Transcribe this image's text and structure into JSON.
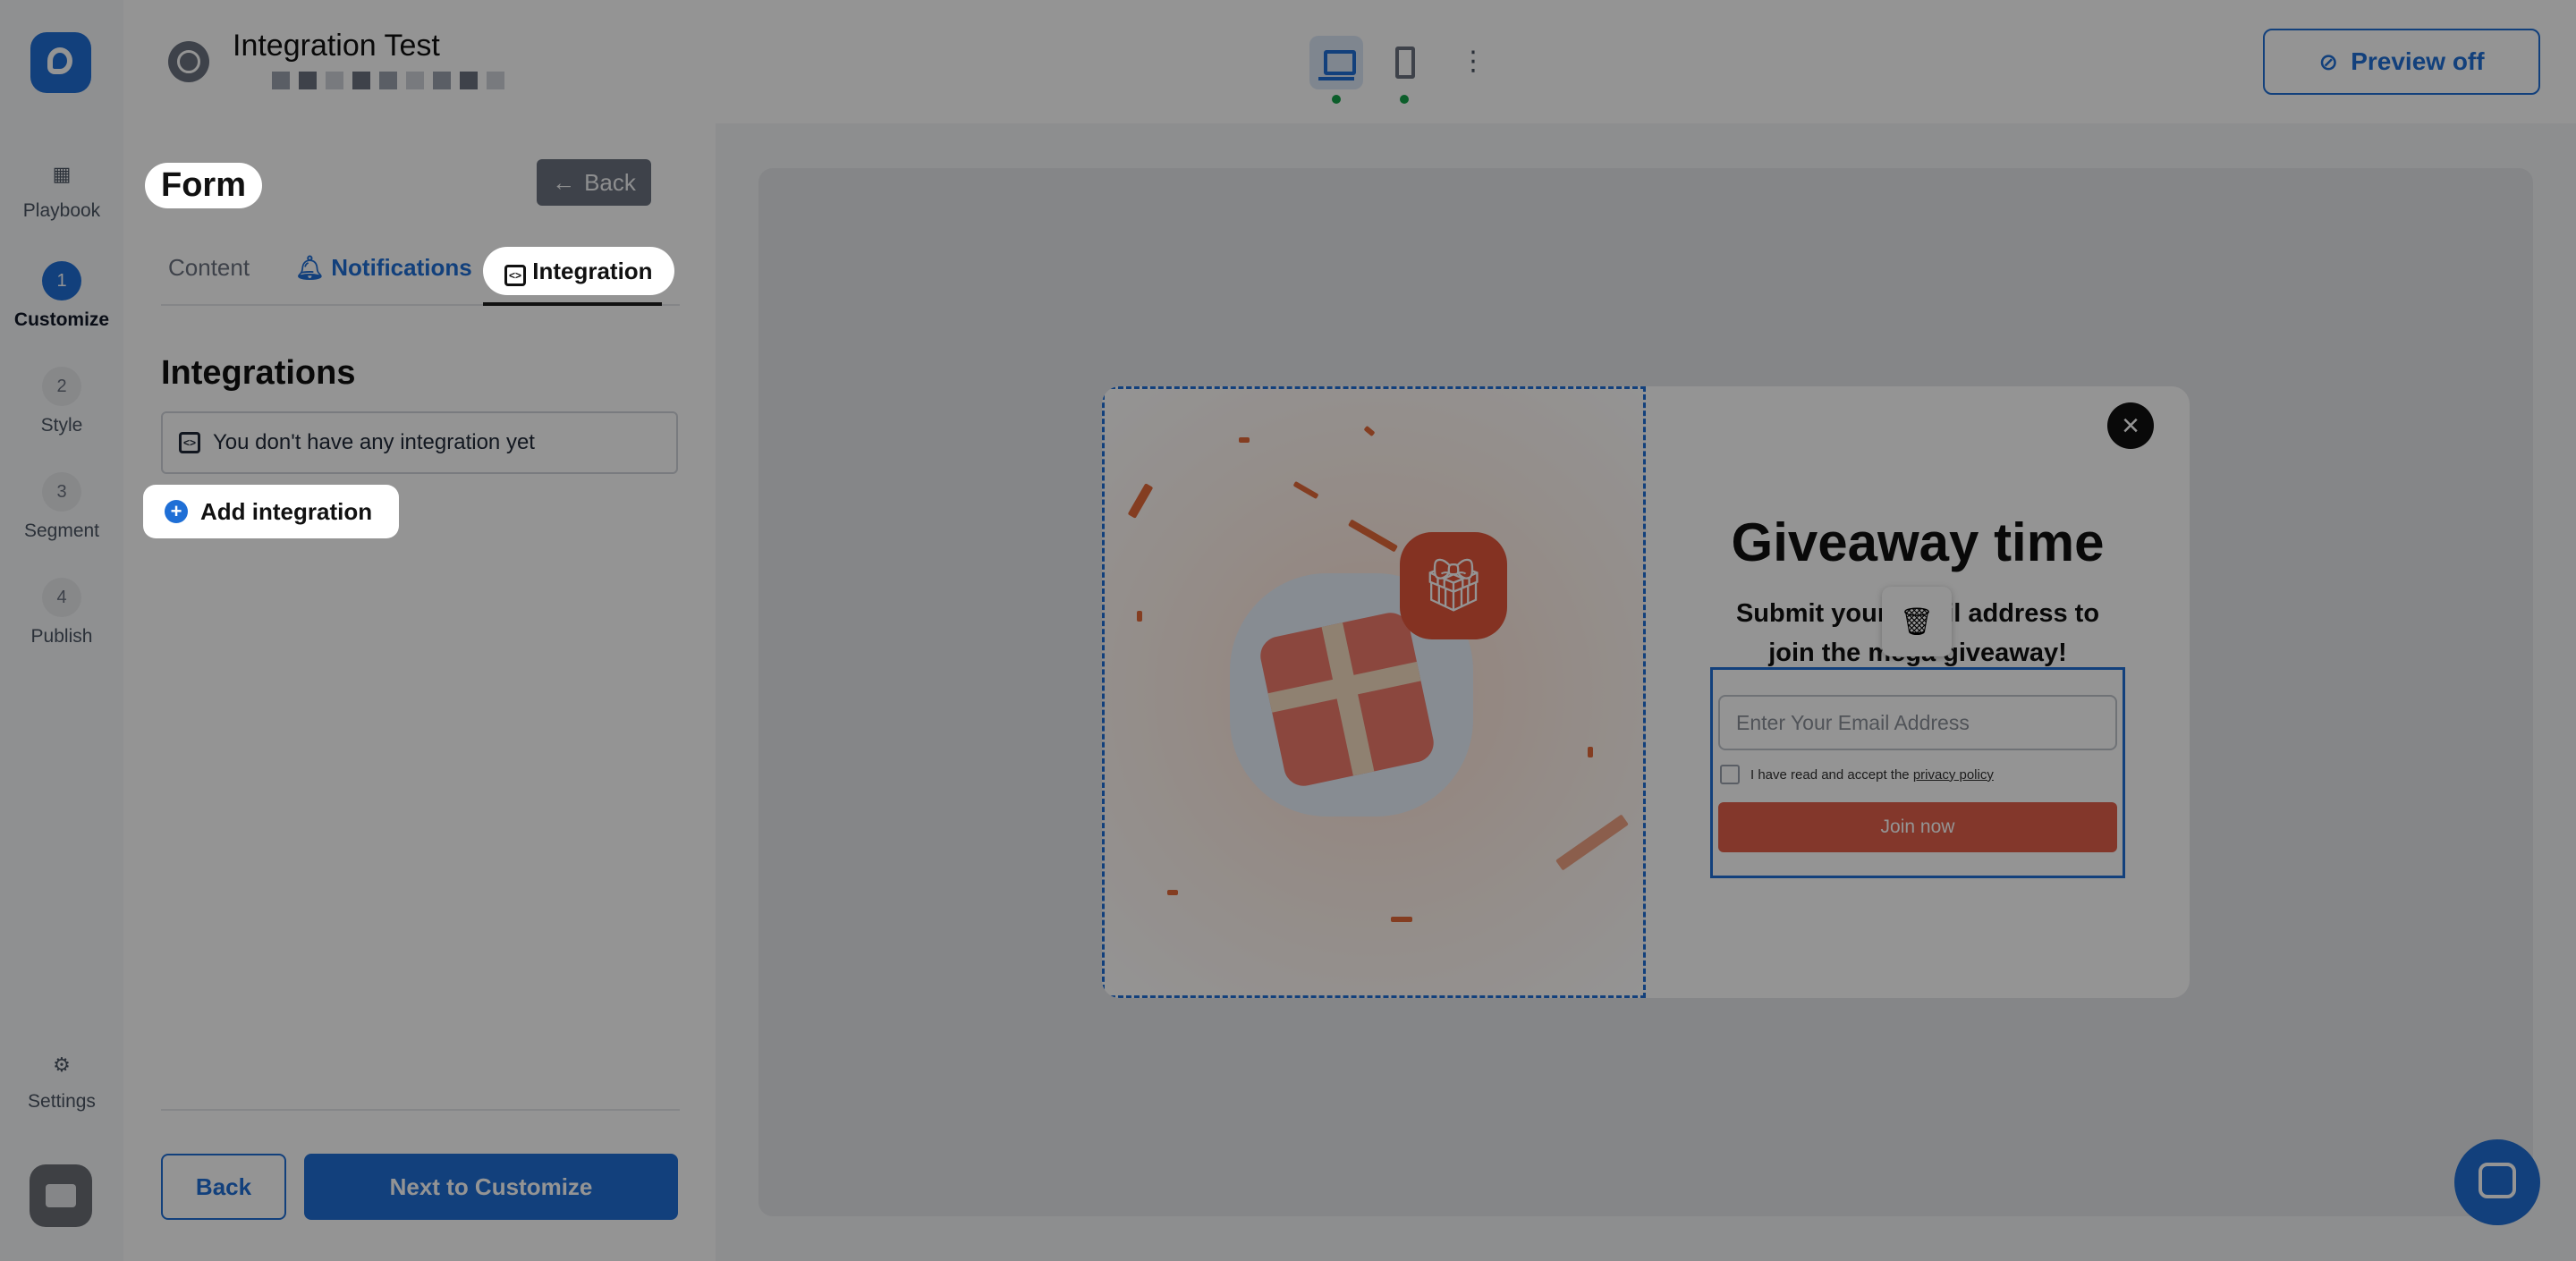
{
  "header": {
    "title": "Integration Test",
    "preview_label": "Preview off"
  },
  "rail": {
    "playbook": "Playbook",
    "customize": "Customize",
    "customize_step": "1",
    "style": "Style",
    "style_step": "2",
    "segment": "Segment",
    "segment_step": "3",
    "publish": "Publish",
    "publish_step": "4",
    "settings": "Settings"
  },
  "panel": {
    "title": "Form",
    "back_top": "Back",
    "tabs": [
      "Content",
      "Notifications",
      "Integration"
    ],
    "section_title": "Integrations",
    "empty_text": "You don't have any integration yet",
    "add_label": "Add integration",
    "back_label": "Back",
    "next_label": "Next to Customize"
  },
  "popup": {
    "headline": "Giveaway time",
    "sub_line1": "Submit your email address to",
    "sub_line2": "join the mega giveaway!",
    "email_placeholder": "Enter Your Email Address",
    "consent_text": "I have read and accept the",
    "consent_link": "privacy policy",
    "join_label": "Join now"
  },
  "colors": {
    "accent": "#1f6fd6",
    "popup_button": "#e2604a",
    "overlay": "rgba(0,0,0,0.42)"
  }
}
